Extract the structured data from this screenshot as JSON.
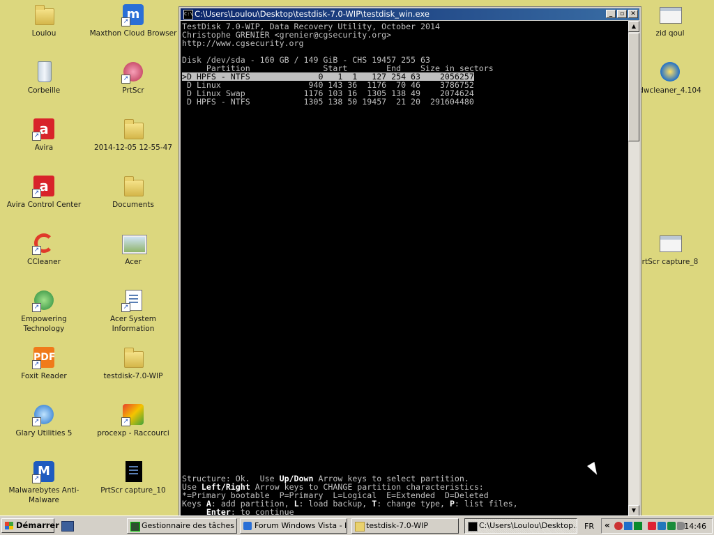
{
  "desktop": {
    "icons_left": [
      {
        "label": "Loulou",
        "icon": "user-folder-icon"
      },
      {
        "label": "Corbeille",
        "icon": "recycle-bin-icon"
      },
      {
        "label": "Avira",
        "icon": "avira-icon"
      },
      {
        "label": "Avira Control Center",
        "icon": "avira-control-center-icon"
      },
      {
        "label": "CCleaner",
        "icon": "ccleaner-icon"
      },
      {
        "label": "Empowering Technology",
        "icon": "empowering-technology-icon"
      },
      {
        "label": "Foxit Reader",
        "icon": "foxit-reader-icon"
      },
      {
        "label": "Glary Utilities 5",
        "icon": "glary-utilities-icon"
      },
      {
        "label": "Malwarebytes Anti-Malware",
        "icon": "malwarebytes-icon"
      }
    ],
    "icons_mid": [
      {
        "label": "Maxthon Cloud Browser",
        "icon": "maxthon-icon"
      },
      {
        "label": "PrtScr",
        "icon": "prtscr-icon"
      },
      {
        "label": "2014-12-05 12-55-47",
        "icon": "folder-icon"
      },
      {
        "label": "Documents",
        "icon": "folder-icon"
      },
      {
        "label": "Acer",
        "icon": "acer-photo-icon"
      },
      {
        "label": "Acer System Information",
        "icon": "document-icon"
      },
      {
        "label": "testdisk-7.0-WIP",
        "icon": "folder-icon"
      },
      {
        "label": "procexp - Raccourci",
        "icon": "procexp-icon"
      },
      {
        "label": "PrtScr capture_10",
        "icon": "capture-icon"
      }
    ],
    "icons_right": [
      {
        "label": "zid  qoul",
        "icon": "document-icon"
      },
      {
        "label": "dwcleaner_4.104",
        "icon": "adwcleaner-icon"
      },
      {
        "label": "rtScr capture_8",
        "icon": "capture-icon"
      }
    ]
  },
  "console": {
    "title": "C:\\Users\\Loulou\\Desktop\\testdisk-7.0-WIP\\testdisk_win.exe",
    "lines": {
      "l1": "TestDisk 7.0-WIP, Data Recovery Utility, October 2014",
      "l2": "Christophe GRENIER <grenier@cgsecurity.org>",
      "l3": "http://www.cgsecurity.org",
      "disk": "Disk /dev/sda - 160 GB / 149 GiB - CHS 19457 255 63",
      "header": "     Partition               Start        End    Size in sectors",
      "p1": ">D HPFS - NTFS              0   1  1   127 254 63    2056257",
      "p2": " D Linux                  940 143 36  1176  70 46    3786752",
      "p3": " D Linux Swap            1176 103 16  1305 138 49    2074624",
      "p4": " D HPFS - NTFS           1305 138 50 19457  21 20  291604480",
      "s1": "Structure: Ok.  Use ",
      "s1b": "Up/Down",
      "s1c": " Arrow keys to select partition.",
      "s2": "Use ",
      "s2b": "Left/Right",
      "s2c": " Arrow keys to CHANGE partition characteristics:",
      "s3": "*=Primary bootable  P=Primary  L=Logical  E=Extended  D=Deleted",
      "s4": "Keys ",
      "s4a": "A",
      "s4b": ": add partition, ",
      "s4c": "L",
      "s4d": ": load backup, ",
      "s4e": "T",
      "s4f": ": change type, ",
      "s4g": "P",
      "s4h": ": list files,",
      "s5": "     ",
      "s5b": "Enter",
      "s5c": ": to continue"
    }
  },
  "taskbar": {
    "start_label": "Démarrer",
    "tasks": [
      {
        "label": "Gestionnaire des tâches ..."
      },
      {
        "label": "Forum Windows Vista - I..."
      },
      {
        "label": "testdisk-7.0-WIP"
      },
      {
        "label": "C:\\Users\\Loulou\\Desktop..."
      }
    ],
    "language": "FR",
    "tray_expand": "«",
    "clock": "14:46"
  }
}
